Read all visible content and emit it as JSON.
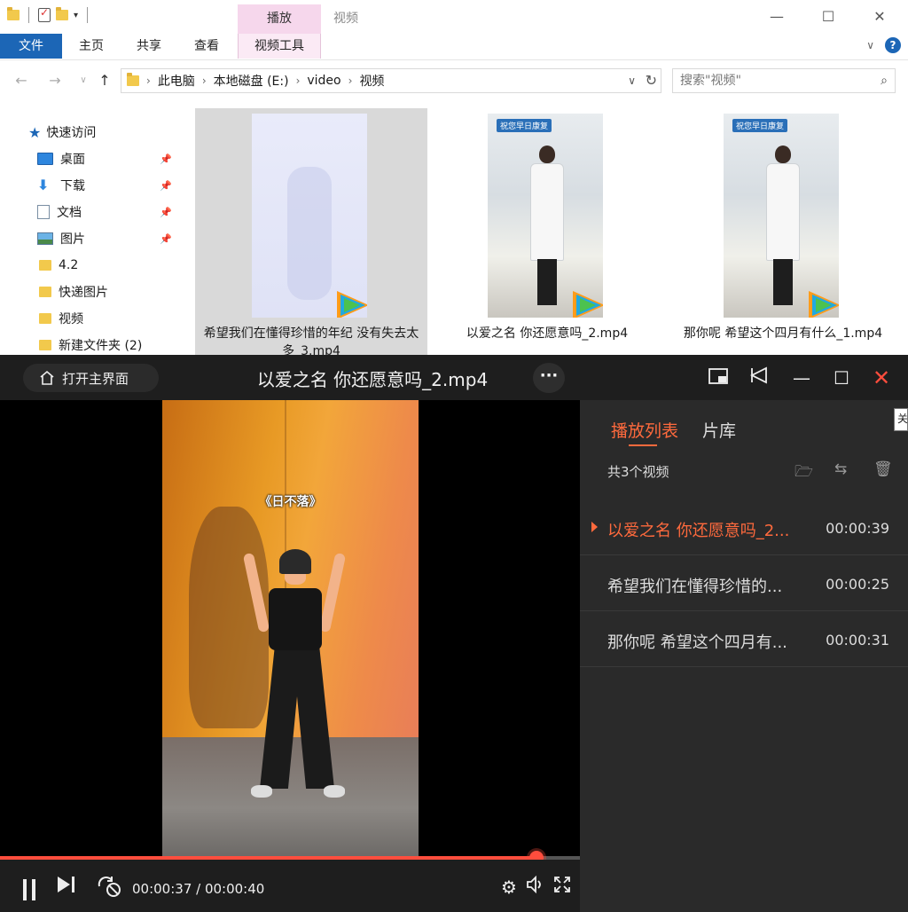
{
  "explorer": {
    "context_tab_header": "播放",
    "window_title": "视频",
    "ribbon_tabs": [
      "文件",
      "主页",
      "共享",
      "查看",
      "视频工具"
    ],
    "breadcrumb": [
      "此电脑",
      "本地磁盘 (E:)",
      "video",
      "视频"
    ],
    "search_placeholder": "搜索\"视频\"",
    "nav": [
      {
        "label": "快速访问",
        "icon": "star-icon"
      },
      {
        "label": "桌面",
        "icon": "desktop-icon",
        "pinned": true
      },
      {
        "label": "下载",
        "icon": "download-icon",
        "pinned": true
      },
      {
        "label": "文档",
        "icon": "document-icon",
        "pinned": true
      },
      {
        "label": "图片",
        "icon": "pictures-icon",
        "pinned": true
      },
      {
        "label": "4.2",
        "icon": "folder-icon"
      },
      {
        "label": "快递图片",
        "icon": "folder-icon"
      },
      {
        "label": "视频",
        "icon": "folder-icon"
      },
      {
        "label": "新建文件夹 (2)",
        "icon": "folder-icon"
      }
    ],
    "files": [
      {
        "name": "希望我们在懂得珍惜的年纪 没有失去太多_3.mp4",
        "selected": true
      },
      {
        "name": "以爱之名 你还愿意吗_2.mp4",
        "badge": "祝您早日康复"
      },
      {
        "name": "那你呢 希望这个四月有什么_1.mp4",
        "badge": "祝您早日康复"
      }
    ]
  },
  "player": {
    "home_button": "打开主界面",
    "title": "以爱之名 你还愿意吗_2.mp4",
    "video_caption": "《日不落》",
    "time_display": "00:00:37 / 00:00:40",
    "progress": 0.925,
    "tabs": [
      "播放列表",
      "片库"
    ],
    "playlist_count": "共3个视频",
    "playlist": [
      {
        "title": "以爱之名 你还愿意吗_2...",
        "duration": "00:00:39",
        "active": true
      },
      {
        "title": "希望我们在懂得珍惜的...",
        "duration": "00:00:25"
      },
      {
        "title": "那你呢 希望这个四月有...",
        "duration": "00:00:31"
      }
    ],
    "tooltip_char": "关",
    "accent_color": "#ff4d3d"
  }
}
